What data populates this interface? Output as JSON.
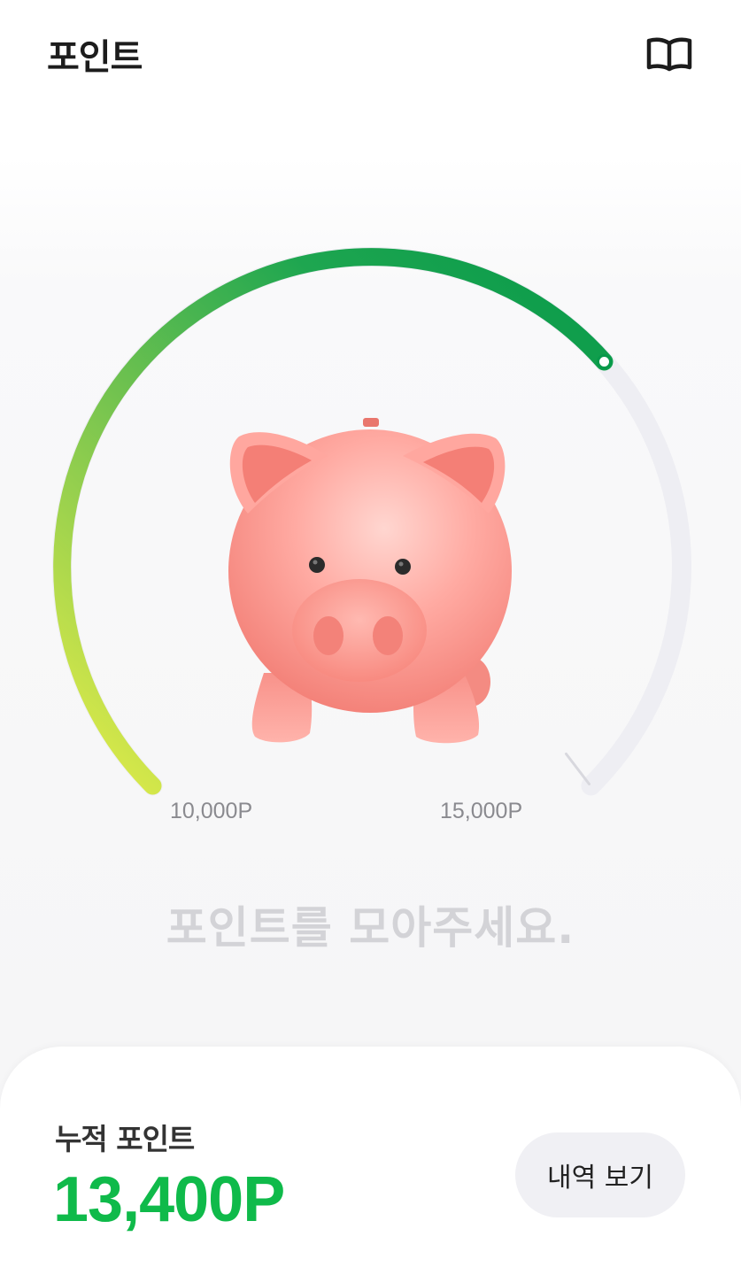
{
  "header": {
    "title": "포인트",
    "guide_icon": "book-open-icon"
  },
  "gauge": {
    "current_points": 13400,
    "min_label": "10,000P",
    "max_label": "15,000P",
    "progress_fraction": 0.68,
    "colors": {
      "start": "#d7e84a",
      "mid": "#6cc04f",
      "end": "#07994a",
      "track": "#eeeef3"
    }
  },
  "illustration": {
    "name": "piggy-bank"
  },
  "prompt_text": "포인트를 모아주세요.",
  "summary": {
    "label": "누적 포인트",
    "value": "13,400P",
    "value_color": "#0fba4a",
    "history_button": "내역 보기"
  }
}
